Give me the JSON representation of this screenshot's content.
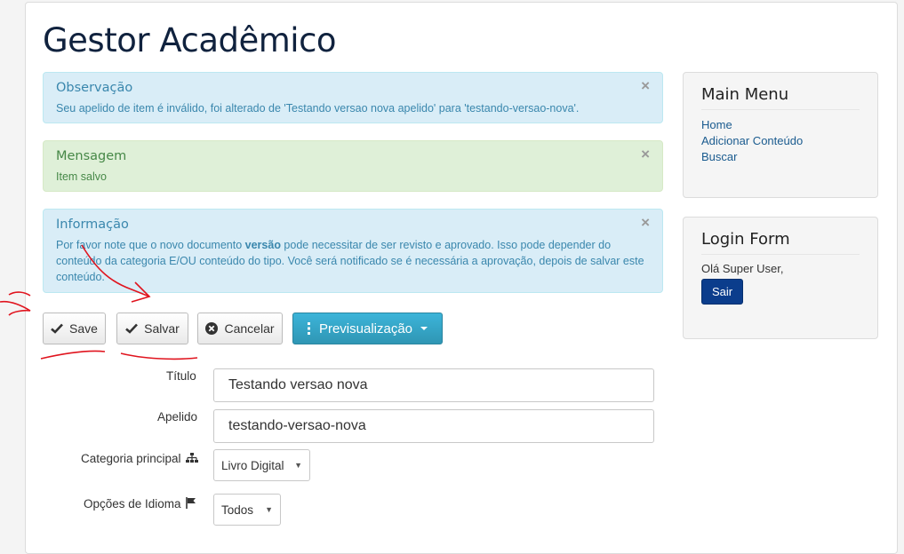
{
  "site": {
    "title": "Gestor Acadêmico"
  },
  "alerts": [
    {
      "type": "info",
      "heading": "Observação",
      "body": "Seu apelido de item é inválido, foi alterado de 'Testando versao nova apelido' para 'testando-versao-nova'.",
      "close": "×"
    },
    {
      "type": "success",
      "heading": "Mensagem",
      "body": "Item salvo",
      "close": "×"
    },
    {
      "type": "info",
      "heading": "Informação",
      "body_before": "Por favor note que o novo documento ",
      "body_bold": "versão",
      "body_after": " pode necessitar de ser revisto e aprovado. Isso pode depender do conteúdo da categoria E/OU conteúdo do tipo. Você será notificado se é necessária a aprovação, depois de salvar este conteúdo.",
      "close": "×"
    }
  ],
  "toolbar": {
    "save_label": "Save",
    "salvar_label": "Salvar",
    "cancel_label": "Cancelar",
    "preview_label": "Previsualização"
  },
  "form": {
    "title_label": "Título",
    "title_value": "Testando versao nova",
    "alias_label": "Apelido",
    "alias_value": "testando-versao-nova",
    "category_label": "Categoria principal",
    "category_value": "Livro Digital",
    "language_label": "Opções de Idioma",
    "language_value": "Todos"
  },
  "sidebar": {
    "main_menu_title": "Main Menu",
    "menu_items": [
      "Home",
      "Adicionar Conteúdo",
      "Buscar"
    ],
    "login_title": "Login Form",
    "greeting": "Olá Super User,",
    "logout_label": "Sair"
  },
  "colors": {
    "info_bg": "#d9edf7",
    "success_bg": "#dff0d8",
    "preview_button": "#2f96b4",
    "logout_button": "#0b3d8c",
    "annotation": "#e0141e"
  },
  "icons": {
    "save": "check-icon",
    "salvar": "check-icon",
    "cancel": "times-circle-icon",
    "preview": "vertical-ellipsis-icon",
    "category": "sitemap-icon",
    "language": "flag-icon"
  }
}
